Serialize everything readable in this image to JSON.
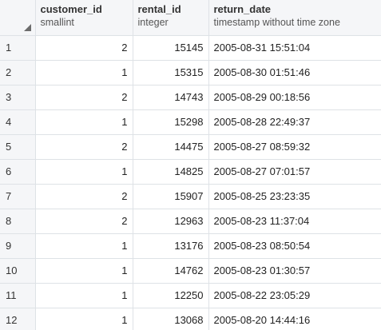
{
  "columns": [
    {
      "name": "customer_id",
      "type": "smallint"
    },
    {
      "name": "rental_id",
      "type": "integer"
    },
    {
      "name": "return_date",
      "type": "timestamp without time zone"
    }
  ],
  "rows": [
    {
      "n": "1",
      "customer_id": "2",
      "rental_id": "15145",
      "return_date": "2005-08-31 15:51:04"
    },
    {
      "n": "2",
      "customer_id": "1",
      "rental_id": "15315",
      "return_date": "2005-08-30 01:51:46"
    },
    {
      "n": "3",
      "customer_id": "2",
      "rental_id": "14743",
      "return_date": "2005-08-29 00:18:56"
    },
    {
      "n": "4",
      "customer_id": "1",
      "rental_id": "15298",
      "return_date": "2005-08-28 22:49:37"
    },
    {
      "n": "5",
      "customer_id": "2",
      "rental_id": "14475",
      "return_date": "2005-08-27 08:59:32"
    },
    {
      "n": "6",
      "customer_id": "1",
      "rental_id": "14825",
      "return_date": "2005-08-27 07:01:57"
    },
    {
      "n": "7",
      "customer_id": "2",
      "rental_id": "15907",
      "return_date": "2005-08-25 23:23:35"
    },
    {
      "n": "8",
      "customer_id": "2",
      "rental_id": "12963",
      "return_date": "2005-08-23 11:37:04"
    },
    {
      "n": "9",
      "customer_id": "1",
      "rental_id": "13176",
      "return_date": "2005-08-23 08:50:54"
    },
    {
      "n": "10",
      "customer_id": "1",
      "rental_id": "14762",
      "return_date": "2005-08-23 01:30:57"
    },
    {
      "n": "11",
      "customer_id": "1",
      "rental_id": "12250",
      "return_date": "2005-08-22 23:05:29"
    },
    {
      "n": "12",
      "customer_id": "1",
      "rental_id": "13068",
      "return_date": "2005-08-20 14:44:16"
    }
  ]
}
